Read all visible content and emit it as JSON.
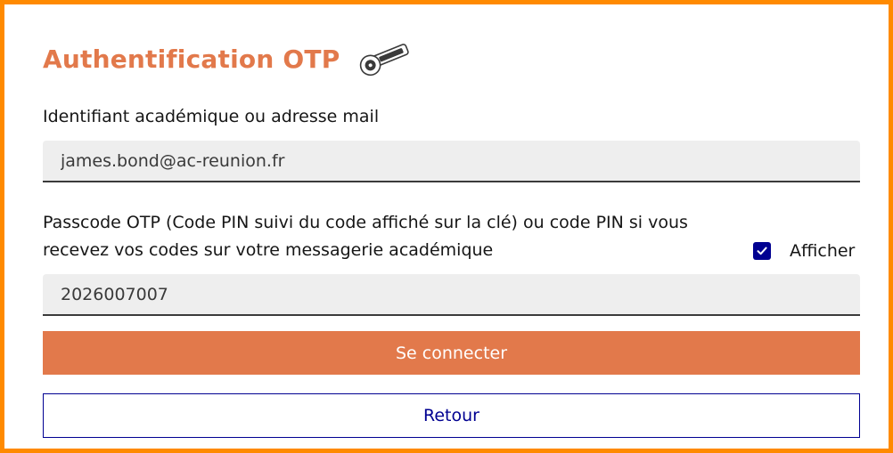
{
  "header": {
    "title": "Authentification OTP",
    "key_icon": "otp-key-icon"
  },
  "form": {
    "identifier_label": "Identifiant académique ou adresse mail",
    "identifier_value": "james.bond@ac-reunion.fr",
    "passcode_label": "Passcode OTP (Code PIN suivi du code affiché sur la clé) ou code PIN si vous recevez vos codes sur votre messagerie académique",
    "passcode_value": "2026007007",
    "show_label": "Afficher",
    "show_checked": true
  },
  "actions": {
    "connect_label": "Se connecter",
    "back_label": "Retour"
  },
  "colors": {
    "accent": "#e2794b",
    "frame": "#ff8a00",
    "primary_blue": "#000091",
    "input_bg": "#eeeeee"
  }
}
